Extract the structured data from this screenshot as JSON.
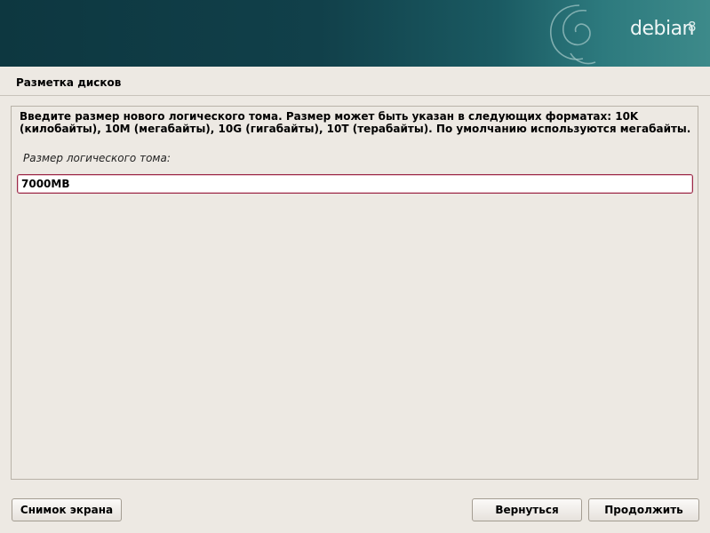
{
  "banner": {
    "brand": "debian",
    "version": "8",
    "logo_icon": "debian-swirl-icon",
    "colors": {
      "dark": "#0d3740",
      "light": "#3d8a8a"
    }
  },
  "page": {
    "title": "Разметка дисков"
  },
  "question": {
    "description": "Введите размер нового логического тома. Размер может быть указан в следующих форматах: 10K (килобайты), 10M (мегабайты), 10G (гигабайты), 10T (терабайты). По умолчанию используются мегабайты.",
    "field_label": "Размер логического тома:",
    "input_value": "7000MB",
    "input_focus_color": "#9c2a48"
  },
  "buttons": {
    "screenshot": "Снимок экрана",
    "back": "Вернуться",
    "continue": "Продолжить"
  }
}
